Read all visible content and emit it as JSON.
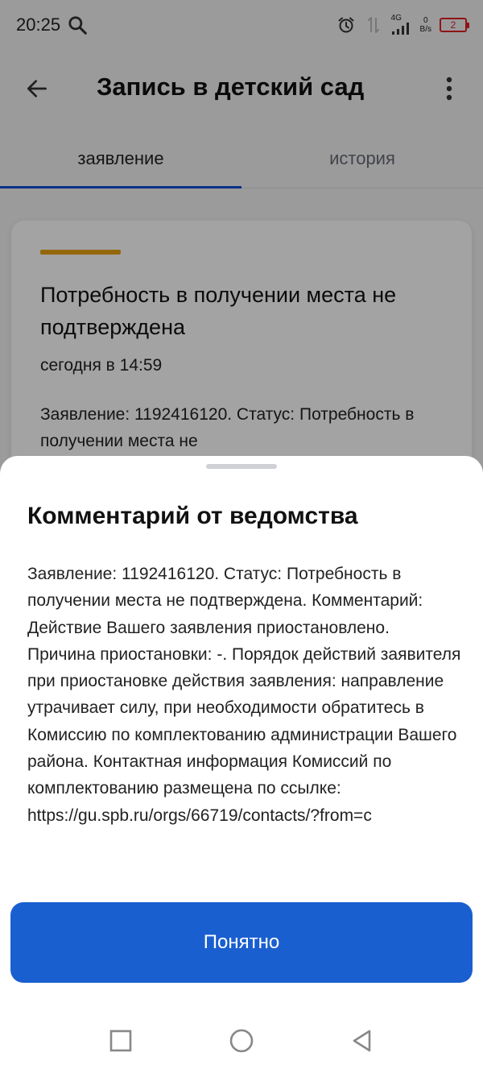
{
  "status_bar": {
    "time": "20:25",
    "network_type": "4G",
    "speed_value": "0",
    "speed_unit": "B/s",
    "battery_level": "2"
  },
  "app_bar": {
    "title": "Запись в детский сад"
  },
  "tabs": [
    {
      "label": "заявление",
      "active": true
    },
    {
      "label": "история",
      "active": false
    }
  ],
  "card": {
    "title": "Потребность в получении места не подтверждена",
    "time": "сегодня в 14:59",
    "text": "Заявление: 1192416120. Статус: Потребность в получении места не"
  },
  "sheet": {
    "title": "Комментарий от ведомства",
    "body": "Заявление: 1192416120. Статус: Потребность в получении места не подтверждена. Комментарий: Действие Вашего заявления приостановлено. Причина приостановки: -. Порядок действий заявителя при приостановке действия заявления: направление утрачивает силу, при необходимости обратитесь в Комиссию по комплектованию администрации Вашего района. Контактная информация Комиссий по комплектованию размещена по ссылке: https://gu.spb.ru/orgs/66719/contacts/?from=c",
    "confirm_label": "Понятно"
  },
  "colors": {
    "accent_blue": "#0d4cd3",
    "button_blue": "#1a5fd0",
    "card_accent": "#e8a310",
    "battery_low": "#e02020"
  },
  "icons": {
    "status_search": "search-icon",
    "status_alarm": "alarm-icon",
    "back": "arrow-left-icon",
    "menu": "more-vertical-icon",
    "nav_recent": "square-icon",
    "nav_home": "circle-icon",
    "nav_back": "triangle-back-icon"
  }
}
